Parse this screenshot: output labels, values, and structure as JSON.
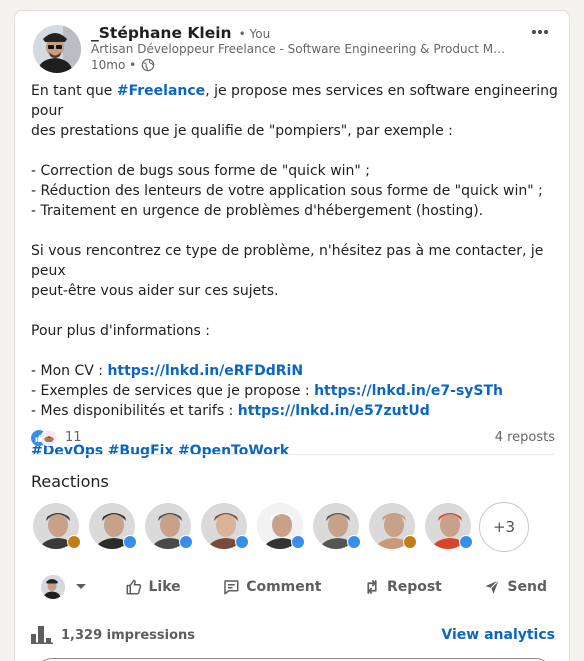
{
  "author": {
    "name": "_Stéphane Klein",
    "relation": "• You",
    "headline": "Artisan Développeur Freelance - Software Engineering & Product Manag…",
    "time": "10mo •",
    "visibility_icon": "globe-icon"
  },
  "post": {
    "lines": [
      {
        "segments": [
          {
            "text": "En tant que "
          },
          {
            "text": "#Freelance",
            "link": true
          },
          {
            "text": ", je propose mes services en software engineering pour"
          }
        ]
      },
      {
        "segments": [
          {
            "text": "des prestations que je qualifie de \"pompiers\", par exemple :"
          }
        ]
      },
      {
        "segments": []
      },
      {
        "segments": [
          {
            "text": "- Correction de bugs sous forme de \"quick win\" ;"
          }
        ]
      },
      {
        "segments": [
          {
            "text": "- Réduction des lenteurs de votre application sous forme de \"quick win\" ;"
          }
        ]
      },
      {
        "segments": [
          {
            "text": "- Traitement en urgence de problèmes d'hébergement (hosting)."
          }
        ]
      },
      {
        "segments": []
      },
      {
        "segments": [
          {
            "text": "Si vous rencontrez ce type de problème, n'hésitez pas à me contacter, je peux"
          }
        ]
      },
      {
        "segments": [
          {
            "text": "peut-être vous aider sur ces sujets."
          }
        ]
      },
      {
        "segments": []
      },
      {
        "segments": [
          {
            "text": "Pour plus d'informations :"
          }
        ]
      },
      {
        "segments": []
      },
      {
        "segments": [
          {
            "text": "- Mon CV : "
          },
          {
            "text": "https://lnkd.in/eRFDdRiN",
            "link": true
          }
        ]
      },
      {
        "segments": [
          {
            "text": "- Exemples de services que je propose : "
          },
          {
            "text": "https://lnkd.in/e7-sySTh",
            "link": true
          }
        ]
      },
      {
        "segments": [
          {
            "text": "- Mes disponibilités et tarifs : "
          },
          {
            "text": "https://lnkd.in/e57zutUd",
            "link": true
          }
        ]
      },
      {
        "segments": []
      },
      {
        "segments": [
          {
            "text": "#DevOps",
            "link": true
          },
          {
            "text": " "
          },
          {
            "text": "#BugFix",
            "link": true
          },
          {
            "text": " "
          },
          {
            "text": "#OpenToWork",
            "link": true
          }
        ]
      }
    ]
  },
  "social": {
    "reaction_count": "11",
    "reposts": "4 reposts",
    "reaction_icons": [
      "like-icon",
      "support-icon"
    ]
  },
  "reactions": {
    "title": "Reactions",
    "more": "+3",
    "people": [
      {
        "bg": "#3a3a3a",
        "badge": "support"
      },
      {
        "bg": "#2b2b2b",
        "badge": "like"
      },
      {
        "bg": "#4a4a4a",
        "badge": "like"
      },
      {
        "bg": "#7a4a38",
        "badge": "like"
      },
      {
        "bg": "#ffffff",
        "badge": "like"
      },
      {
        "bg": "#555555",
        "badge": "like"
      },
      {
        "bg": "#c89a7a",
        "badge": "support"
      },
      {
        "bg": "#d9442b",
        "badge": "like"
      }
    ]
  },
  "actions": {
    "like": "Like",
    "comment": "Comment",
    "repost": "Repost",
    "send": "Send"
  },
  "analytics": {
    "impressions": "1,329 impressions",
    "view": "View analytics"
  },
  "colors": {
    "link": "#0a66c2",
    "like": "#378fe9",
    "support": "#c37d16"
  }
}
